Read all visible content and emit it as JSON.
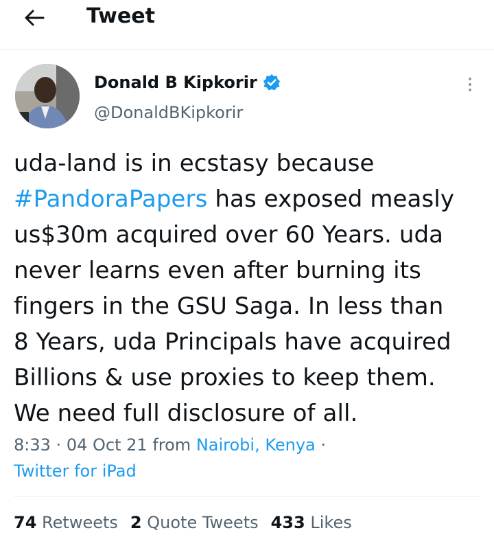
{
  "header": {
    "title": "Tweet",
    "back_icon": "arrow-left-icon"
  },
  "tweet": {
    "author": {
      "name": "Donald B Kipkorir",
      "handle": "@DonaldBKipkorir",
      "verified": true
    },
    "text_lines": [
      {
        "plain": "uda-land is in ecstasy because"
      },
      {
        "hashtag": "#PandoraPapers",
        "plain": " has exposed measly"
      },
      {
        "plain": "us$30m acquired over 60 Years. uda"
      },
      {
        "plain": "never learns even after burning its"
      },
      {
        "plain": "fingers in the GSU Saga. In less than"
      },
      {
        "plain": "8 Years, uda Principals have acquired"
      },
      {
        "plain": "Billions & use proxies to keep them."
      },
      {
        "plain": "We need full disclosure of all."
      }
    ],
    "time": "8:33",
    "separator": "·",
    "date": "04 Oct 21",
    "from_label": "from",
    "location": "Nairobi, Kenya",
    "source": "Twitter for iPad"
  },
  "stats": {
    "retweets_count": "74",
    "retweets_label": "Retweets",
    "quotes_count": "2",
    "quotes_label": "Quote Tweets",
    "likes_count": "433",
    "likes_label": "Likes"
  },
  "colors": {
    "accent": "#1d9bf0",
    "secondary_text": "#536471",
    "primary_text": "#0f1419",
    "divider": "#e6ecf0"
  }
}
